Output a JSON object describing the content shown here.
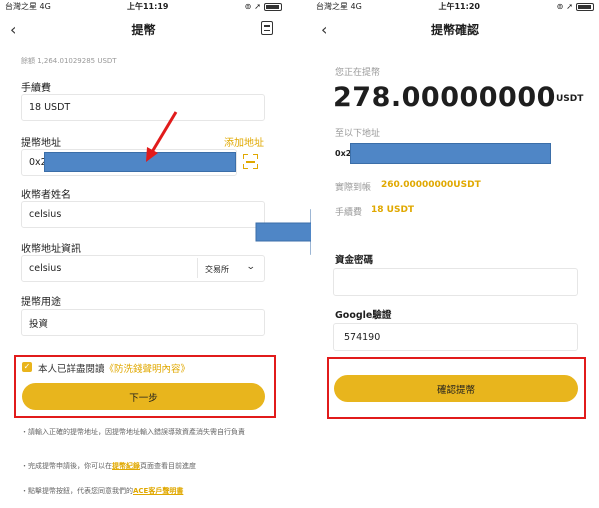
{
  "left_screen": {
    "status": {
      "carrier": "台灣之星",
      "network": "4G",
      "time": "上午11:19"
    },
    "nav": {
      "back": "‹",
      "title": "提幣"
    },
    "balance_text": "餘額 1,264.01029285 USDT",
    "fee": {
      "label": "手續費",
      "value": "18 USDT"
    },
    "address": {
      "label": "提幣地址",
      "add_link": "添加地址",
      "prefix": "0x2"
    },
    "recipient_name": {
      "label": "收幣者姓名",
      "value": "celsius"
    },
    "recipient_info": {
      "label": "收幣地址資訊",
      "value": "celsius",
      "select_value": "交易所"
    },
    "purpose": {
      "label": "提幣用途",
      "value": "投資"
    },
    "agree": {
      "prefix": "本人已詳盡閱讀",
      "link": "《防洗錢聲明內容》"
    },
    "next_button": "下一步",
    "notes": {
      "n1": "・請輸入正確的提幣地址，因提幣地址輸入錯誤導致資產消失需自行負責",
      "n2_prefix": "・完成提幣申請後，你可以在",
      "n2_link": "提幣紀錄",
      "n2_suffix": "頁面查看目前進度",
      "n3_prefix": "・點擊提幣按鈕，代表您同意我們的",
      "n3_link": "ACE客戶聲明書"
    }
  },
  "right_screen": {
    "status": {
      "carrier": "台灣之星",
      "network": "4G",
      "time": "上午11:20"
    },
    "nav": {
      "back": "‹",
      "title": "提幣確認"
    },
    "withdrawing_label": "您正在提幣",
    "amount": "278.00000000",
    "unit": "USDT",
    "to_address_label": "至以下地址",
    "address_prefix": "0x2",
    "actual_label": "實際到帳",
    "actual_value": "260.00000000USDT",
    "fee_label": "手續費",
    "fee_value": "18 USDT",
    "fund_password_label": "資金密碼",
    "fund_password_value": "",
    "google_label": "Google驗證",
    "google_value": "574190",
    "confirm_button": "確認提幣"
  },
  "colors": {
    "accent": "#e8b51d",
    "highlight": "#e11b1b",
    "mask": "#4f86c6"
  }
}
